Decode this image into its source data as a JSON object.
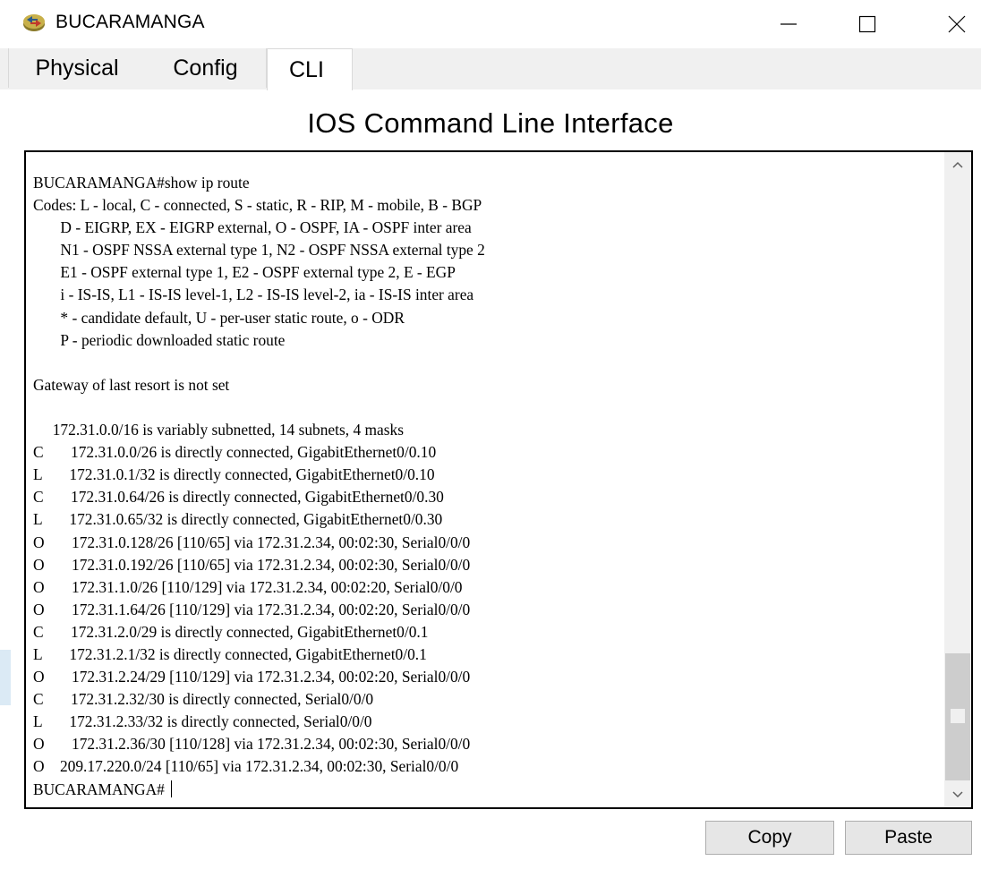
{
  "window": {
    "title": "BUCARAMANGA",
    "icon": "router-icon",
    "controls": [
      "minimize-icon",
      "maximize-icon",
      "close-icon"
    ]
  },
  "tabs": [
    {
      "label": "Physical",
      "active": false
    },
    {
      "label": "Config",
      "active": false
    },
    {
      "label": "CLI",
      "active": true
    }
  ],
  "heading": "IOS Command Line Interface",
  "terminal": {
    "lines": [
      "BUCARAMANGA#show ip route",
      "Codes: L - local, C - connected, S - static, R - RIP, M - mobile, B - BGP",
      "       D - EIGRP, EX - EIGRP external, O - OSPF, IA - OSPF inter area",
      "       N1 - OSPF NSSA external type 1, N2 - OSPF NSSA external type 2",
      "       E1 - OSPF external type 1, E2 - OSPF external type 2, E - EGP",
      "       i - IS-IS, L1 - IS-IS level-1, L2 - IS-IS level-2, ia - IS-IS inter area",
      "       * - candidate default, U - per-user static route, o - ODR",
      "       P - periodic downloaded static route",
      "",
      "Gateway of last resort is not set",
      "",
      "     172.31.0.0/16 is variably subnetted, 14 subnets, 4 masks",
      "C       172.31.0.0/26 is directly connected, GigabitEthernet0/0.10",
      "L       172.31.0.1/32 is directly connected, GigabitEthernet0/0.10",
      "C       172.31.0.64/26 is directly connected, GigabitEthernet0/0.30",
      "L       172.31.0.65/32 is directly connected, GigabitEthernet0/0.30",
      "O       172.31.0.128/26 [110/65] via 172.31.2.34, 00:02:30, Serial0/0/0",
      "O       172.31.0.192/26 [110/65] via 172.31.2.34, 00:02:30, Serial0/0/0",
      "O       172.31.1.0/26 [110/129] via 172.31.2.34, 00:02:20, Serial0/0/0",
      "O       172.31.1.64/26 [110/129] via 172.31.2.34, 00:02:20, Serial0/0/0",
      "C       172.31.2.0/29 is directly connected, GigabitEthernet0/0.1",
      "L       172.31.2.1/32 is directly connected, GigabitEthernet0/0.1",
      "O       172.31.2.24/29 [110/129] via 172.31.2.34, 00:02:20, Serial0/0/0",
      "C       172.31.2.32/30 is directly connected, Serial0/0/0",
      "L       172.31.2.33/32 is directly connected, Serial0/0/0",
      "O       172.31.2.36/30 [110/128] via 172.31.2.34, 00:02:30, Serial0/0/0",
      "O    209.17.220.0/24 [110/65] via 172.31.2.34, 00:02:30, Serial0/0/0"
    ],
    "prompt": "BUCARAMANGA# "
  },
  "buttons": {
    "copy": "Copy",
    "paste": "Paste"
  }
}
